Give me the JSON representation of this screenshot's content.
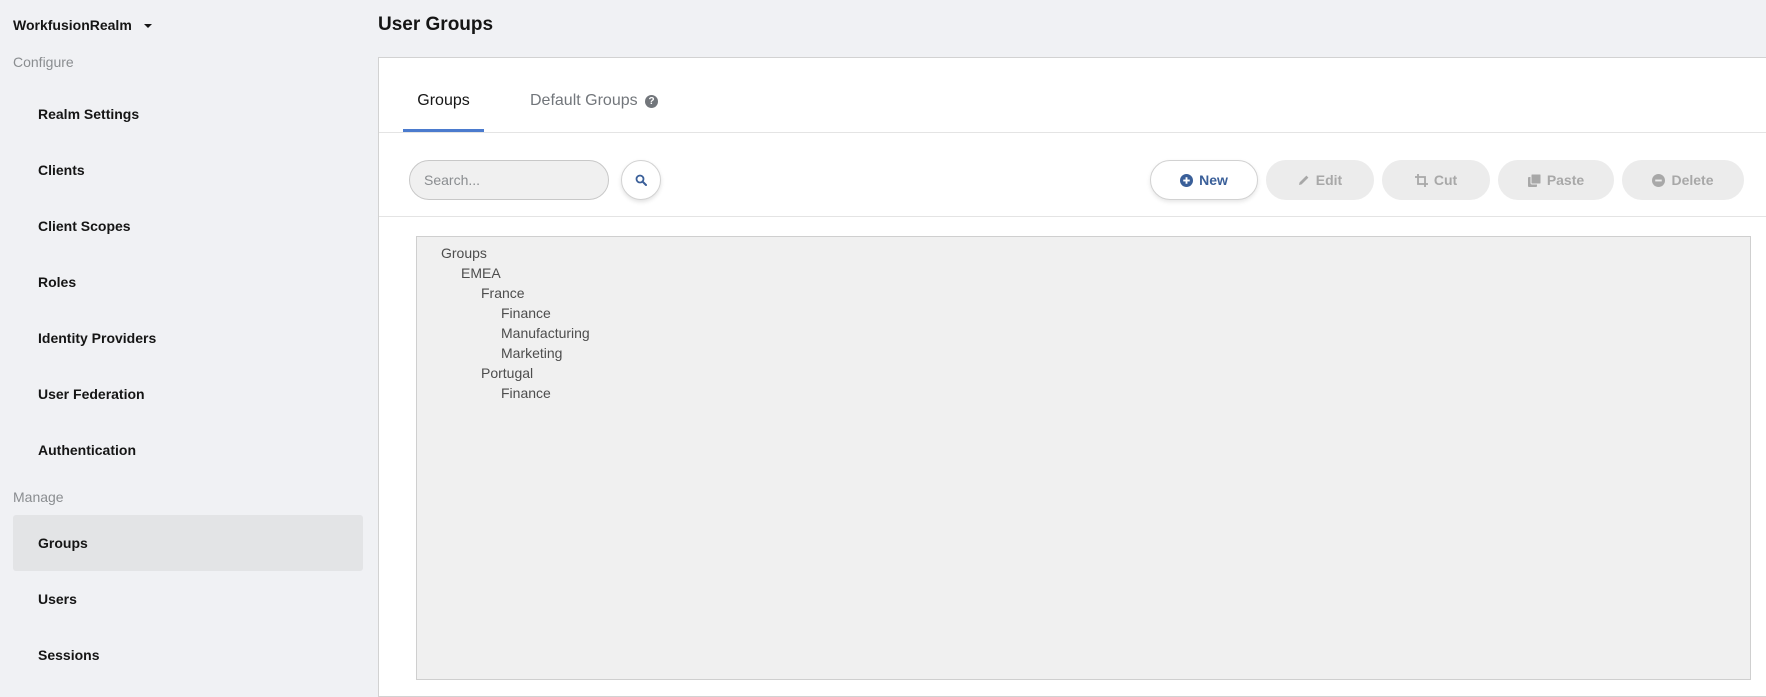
{
  "sidebar": {
    "realm_name": "WorkfusionRealm",
    "sections": [
      {
        "label": "Configure",
        "items": [
          {
            "label": "Realm Settings"
          },
          {
            "label": "Clients"
          },
          {
            "label": "Client Scopes"
          },
          {
            "label": "Roles"
          },
          {
            "label": "Identity Providers"
          },
          {
            "label": "User Federation"
          },
          {
            "label": "Authentication"
          }
        ]
      },
      {
        "label": "Manage",
        "items": [
          {
            "label": "Groups",
            "active": true
          },
          {
            "label": "Users"
          },
          {
            "label": "Sessions"
          }
        ]
      }
    ]
  },
  "page": {
    "title": "User Groups"
  },
  "tabs": [
    {
      "label": "Groups",
      "active": true
    },
    {
      "label": "Default Groups",
      "help_icon": "question-circle-icon"
    }
  ],
  "toolbar": {
    "search_placeholder": "Search...",
    "search_icon": "search-icon",
    "buttons": {
      "new": {
        "label": "New",
        "icon": "plus-circle-icon",
        "enabled": true
      },
      "edit": {
        "label": "Edit",
        "icon": "pencil-icon",
        "enabled": false
      },
      "cut": {
        "label": "Cut",
        "icon": "crop-icon",
        "enabled": false
      },
      "paste": {
        "label": "Paste",
        "icon": "clipboard-icon",
        "enabled": false
      },
      "delete": {
        "label": "Delete",
        "icon": "minus-circle-icon",
        "enabled": false
      }
    }
  },
  "tree": [
    {
      "label": "Groups",
      "depth": 0
    },
    {
      "label": "EMEA",
      "depth": 1
    },
    {
      "label": "France",
      "depth": 2
    },
    {
      "label": "Finance",
      "depth": 3
    },
    {
      "label": "Manufacturing",
      "depth": 3
    },
    {
      "label": "Marketing",
      "depth": 3
    },
    {
      "label": "Portugal",
      "depth": 2
    },
    {
      "label": "Finance",
      "depth": 3
    }
  ],
  "colors": {
    "accent": "#4b7bce",
    "primary_button_text": "#3a5f99",
    "disabled_text": "#a8a8a8",
    "sidebar_bg": "#f0f1f4",
    "active_nav_bg": "#e3e4e6"
  }
}
